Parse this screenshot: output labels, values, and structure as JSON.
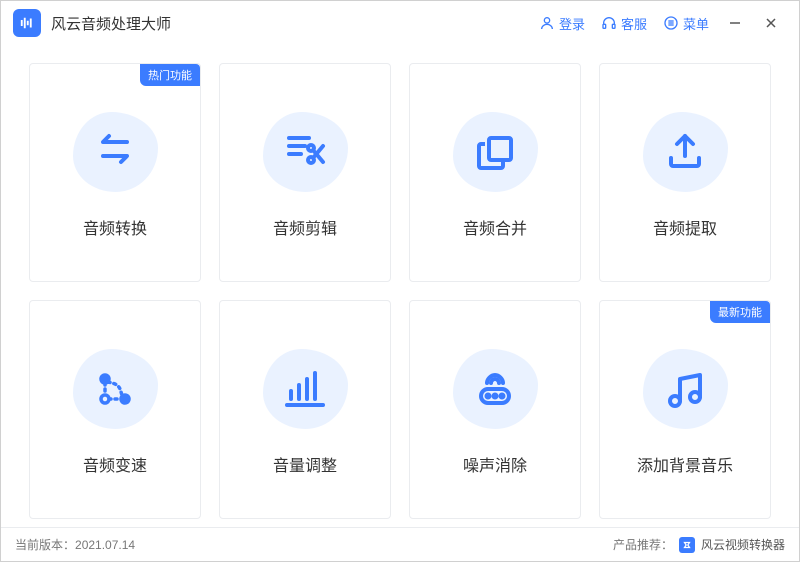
{
  "app": {
    "title": "风云音频处理大师"
  },
  "titlebar": {
    "login": "登录",
    "service": "客服",
    "menu": "菜单"
  },
  "cards": [
    {
      "label": "音频转换",
      "badge": "热门功能",
      "icon": "convert"
    },
    {
      "label": "音频剪辑",
      "badge": null,
      "icon": "cut"
    },
    {
      "label": "音频合并",
      "badge": null,
      "icon": "merge"
    },
    {
      "label": "音频提取",
      "badge": null,
      "icon": "extract"
    },
    {
      "label": "音频变速",
      "badge": null,
      "icon": "speed"
    },
    {
      "label": "音量调整",
      "badge": null,
      "icon": "volume"
    },
    {
      "label": "噪声消除",
      "badge": null,
      "icon": "denoise"
    },
    {
      "label": "添加背景音乐",
      "badge": "最新功能",
      "icon": "bgm"
    }
  ],
  "footer": {
    "version_label": "当前版本：",
    "version": "2021.07.14",
    "recommend_label": "产品推荐：",
    "recommend_name": "风云视频转换器"
  }
}
